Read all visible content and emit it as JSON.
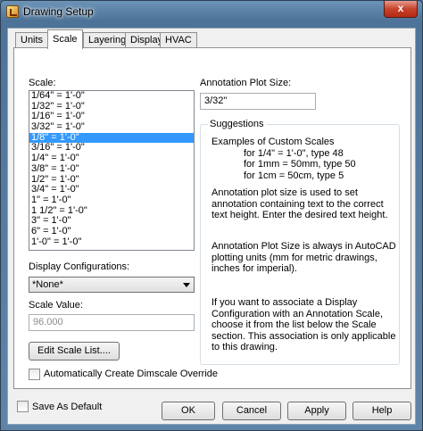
{
  "window": {
    "title": "Drawing Setup",
    "close_glyph": "x"
  },
  "tabs": [
    {
      "label": "Units"
    },
    {
      "label": "Scale"
    },
    {
      "label": "Layering"
    },
    {
      "label": "Display"
    },
    {
      "label": "HVAC"
    }
  ],
  "scale": {
    "label": "Scale:",
    "items": [
      "1/64\" = 1'-0\"",
      "1/32\" = 1'-0\"",
      "1/16\" = 1'-0\"",
      "3/32\" = 1'-0\"",
      "1/8\" = 1'-0\"",
      "3/16\" = 1'-0\"",
      "1/4\" = 1'-0\"",
      "3/8\" = 1'-0\"",
      "1/2\" = 1'-0\"",
      "3/4\" = 1'-0\"",
      "1\" = 1'-0\"",
      "1 1/2\" = 1'-0\"",
      "3\" = 1'-0\"",
      "6\" = 1'-0\"",
      "1'-0\" = 1'-0\""
    ],
    "selected_index": 4
  },
  "display_config": {
    "label": "Display Configurations:",
    "value": "*None*"
  },
  "scale_value": {
    "label": "Scale Value:",
    "value": "96.000"
  },
  "edit_scale_list_button": "Edit Scale List....",
  "auto_dimscale_label": "Automatically Create Dimscale Override",
  "annotation": {
    "label": "Annotation Plot Size:",
    "value": "3/32\""
  },
  "suggestions": {
    "title": "Suggestions",
    "examples_heading": "Examples of Custom Scales",
    "examples": [
      "for 1/4\" = 1'-0\", type 48",
      "for 1mm = 50mm, type 50",
      "for 1cm = 50cm, type 5"
    ],
    "p1": "Annotation plot size is used to set annotation containing text to the correct text height. Enter the desired text height.",
    "p2": "Annotation Plot Size is always in AutoCAD plotting units (mm for metric drawings, inches for imperial).",
    "p3": "If you want to associate a Display Configuration with an Annotation Scale, choose it from the list below the Scale section. This association is only applicable to this drawing."
  },
  "footer": {
    "save_default_label": "Save As Default",
    "ok": "OK",
    "cancel": "Cancel",
    "apply": "Apply",
    "help": "Help"
  }
}
